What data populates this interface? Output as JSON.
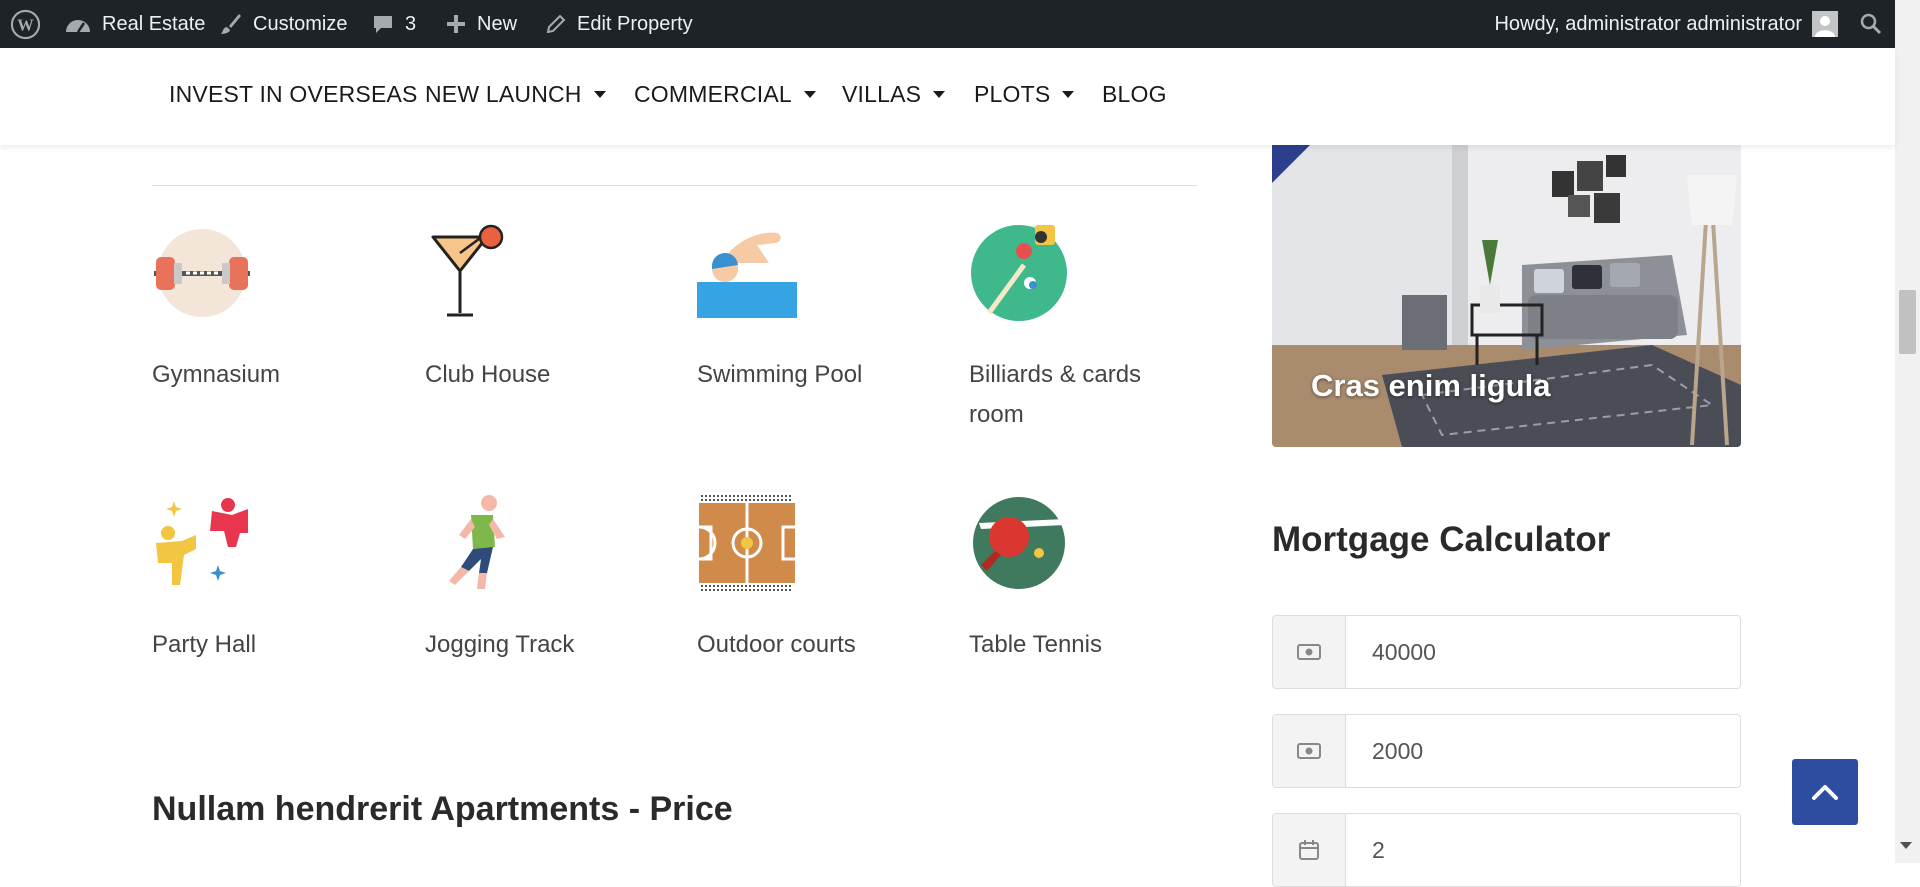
{
  "admin_bar": {
    "site_name": "Real Estate",
    "customize_label": "Customize",
    "comments_count": "3",
    "new_label": "New",
    "edit_label": "Edit Property",
    "greeting": "Howdy, administrator administrator"
  },
  "nav": {
    "items": [
      {
        "label": "INVEST IN OVERSEAS",
        "dropdown": false
      },
      {
        "label": "NEW LAUNCH",
        "dropdown": true
      },
      {
        "label": "COMMERCIAL",
        "dropdown": true
      },
      {
        "label": "VILLAS",
        "dropdown": true
      },
      {
        "label": "PLOTS",
        "dropdown": true
      },
      {
        "label": "BLOG",
        "dropdown": false
      }
    ]
  },
  "amenities": [
    {
      "label": "Gymnasium",
      "icon": "dumbbell-icon"
    },
    {
      "label": "Club House",
      "icon": "cocktail-icon"
    },
    {
      "label": "Swimming Pool",
      "icon": "swimmer-icon"
    },
    {
      "label": "Billiards & cards room",
      "icon": "billiards-icon"
    },
    {
      "label": "Party Hall",
      "icon": "dancing-people-icon"
    },
    {
      "label": "Jogging Track",
      "icon": "runner-icon"
    },
    {
      "label": "Outdoor courts",
      "icon": "basketball-court-icon"
    },
    {
      "label": "Table Tennis",
      "icon": "table-tennis-icon"
    }
  ],
  "section_title": "Nullam hendrerit Apartments - Price",
  "sidebar": {
    "featured_caption": "Cras enim ligula",
    "mortgage_title": "Mortgage Calculator",
    "fields": [
      {
        "value": "40000",
        "icon": "money-icon"
      },
      {
        "value": "2000",
        "icon": "money-icon"
      },
      {
        "value": "2",
        "icon": "calendar-icon"
      }
    ]
  },
  "colors": {
    "admin_bar_bg": "#1d2327",
    "accent": "#2d4da0"
  }
}
